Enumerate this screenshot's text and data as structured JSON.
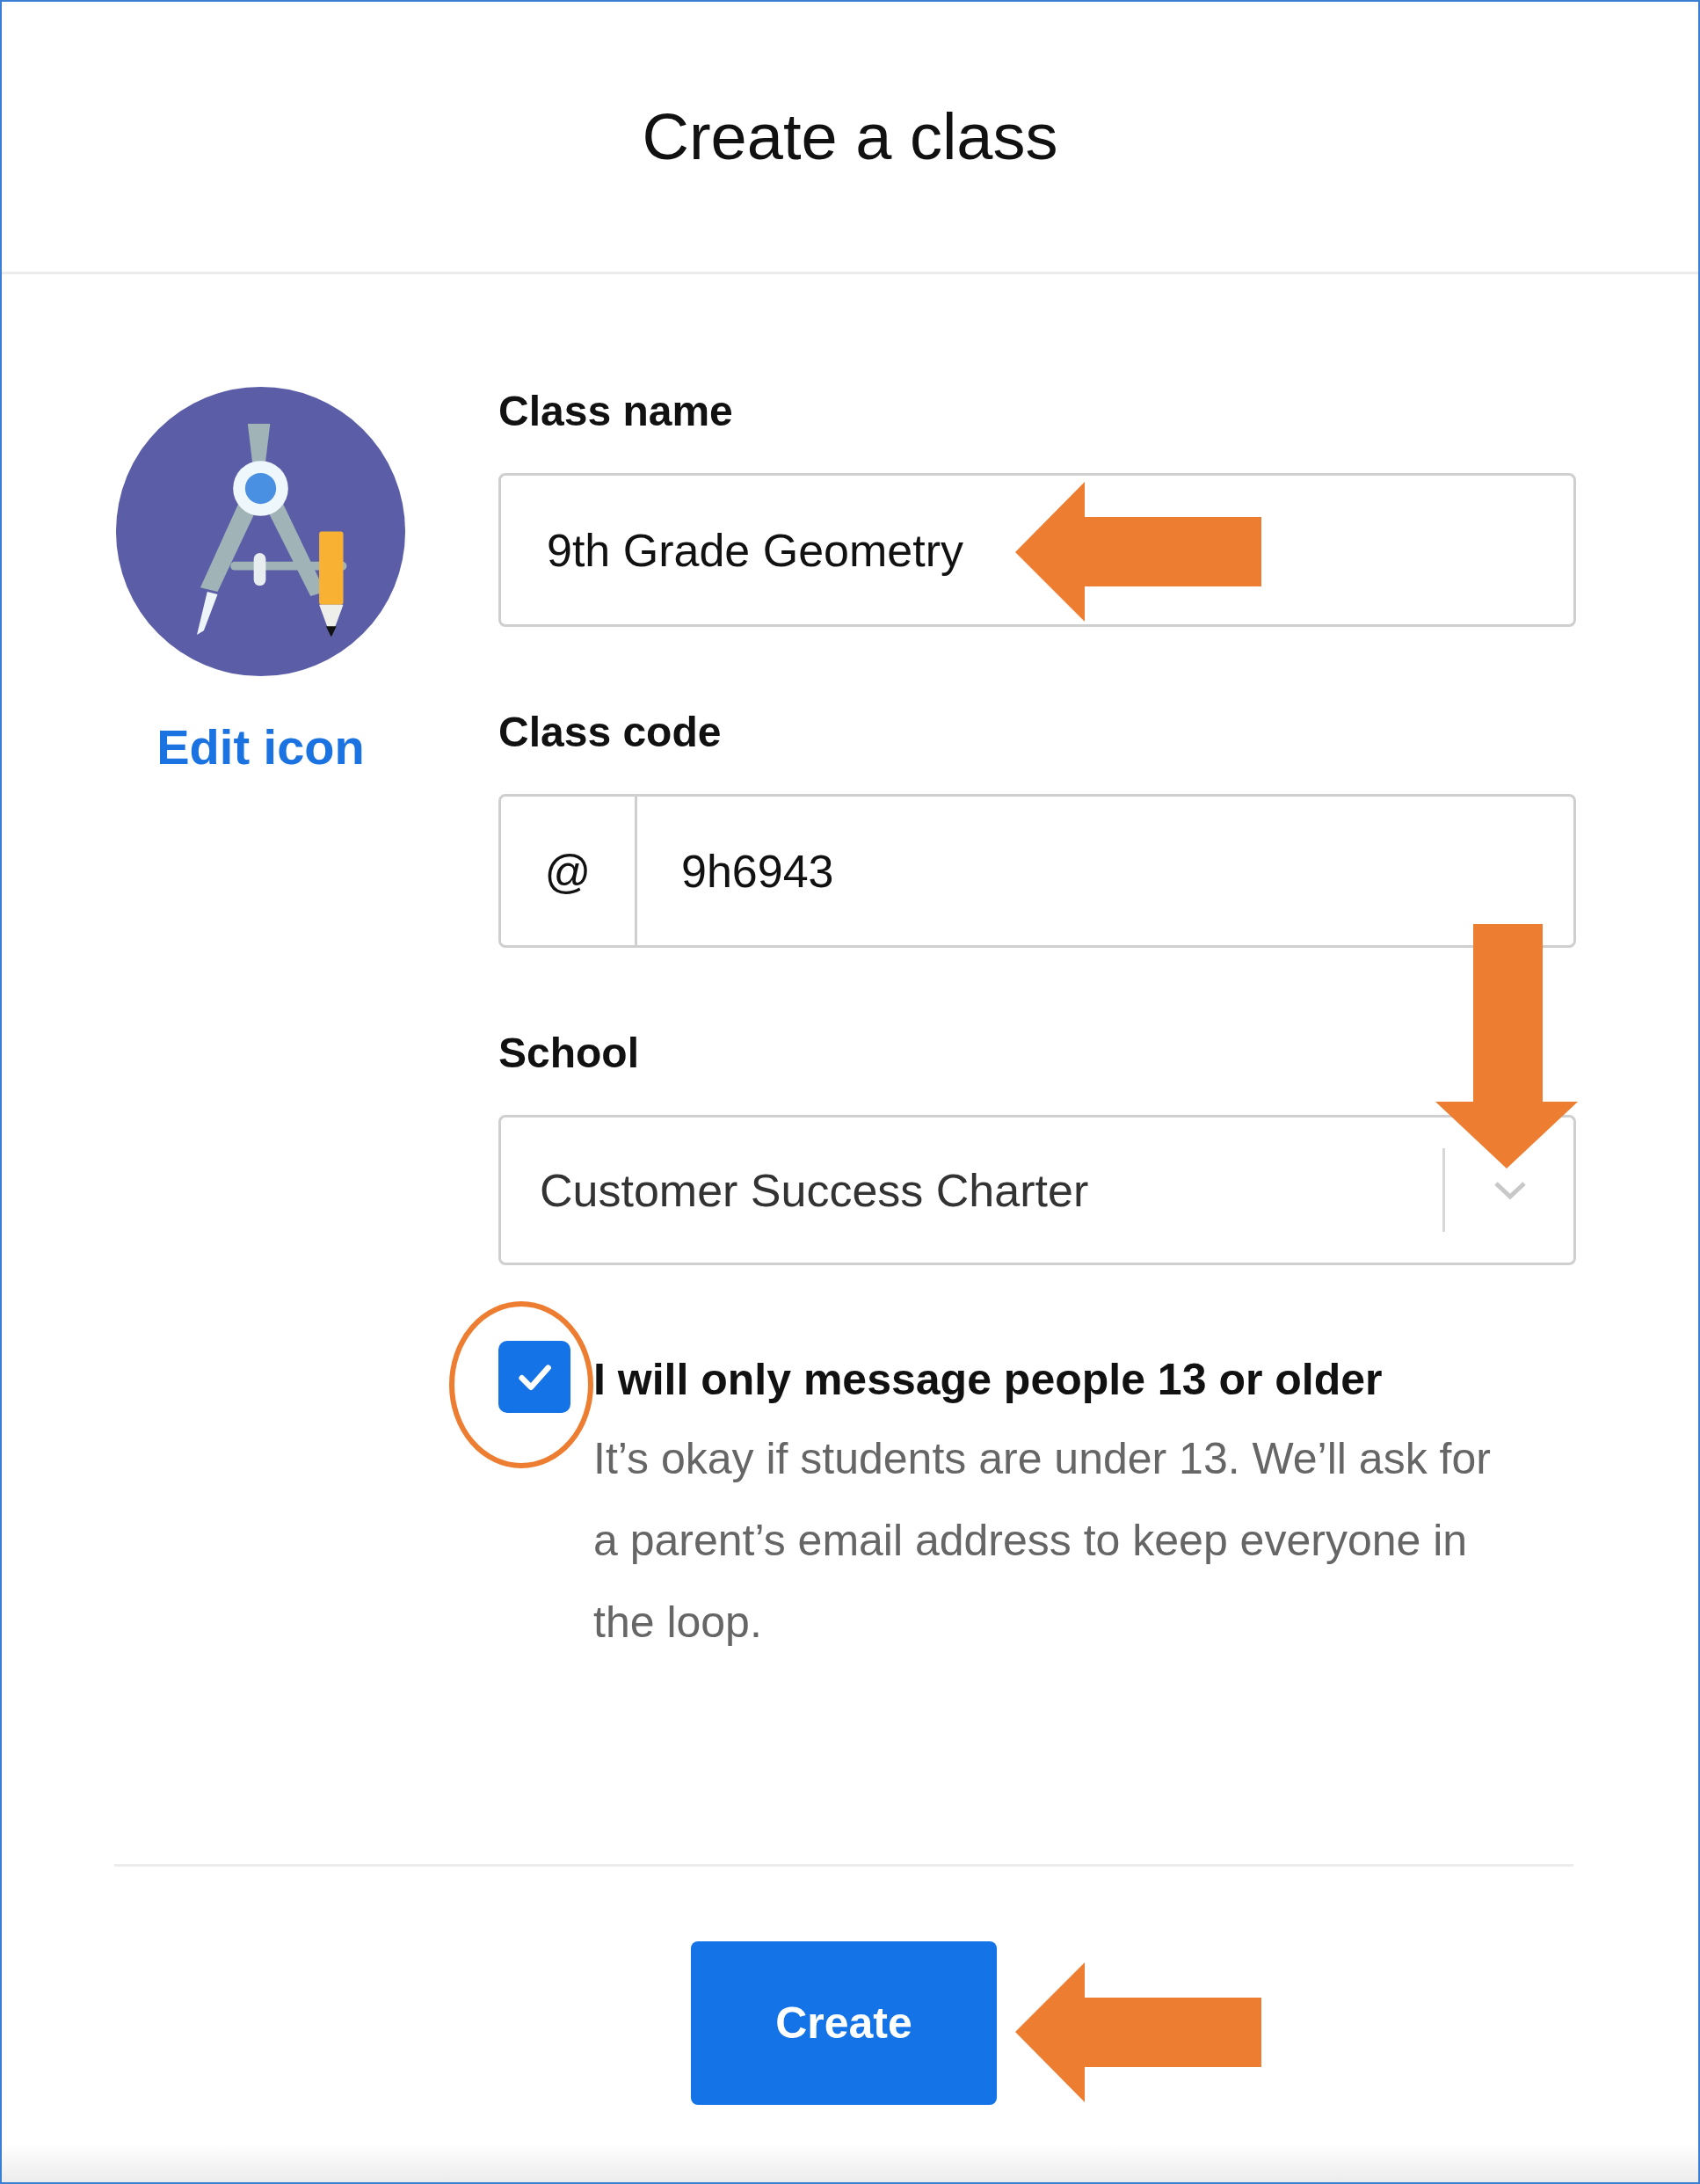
{
  "title": "Create a class",
  "class_icon": {
    "link": "Edit icon"
  },
  "fields": [
    {
      "kind": "text",
      "label": "Class name",
      "value": "9th Grade Geometry"
    },
    {
      "kind": "prefixed",
      "label": "Class code",
      "prefix": "@",
      "value": "9h6943"
    },
    {
      "kind": "select",
      "label": "School",
      "value": "Customer Success Charter"
    }
  ],
  "consent": {
    "checked": true,
    "label": "I will only message people 13 or older",
    "note": "It’s okay if students are under 13. We’ll ask for a parent’s email address to keep everyone in the loop."
  },
  "button": "Create"
}
